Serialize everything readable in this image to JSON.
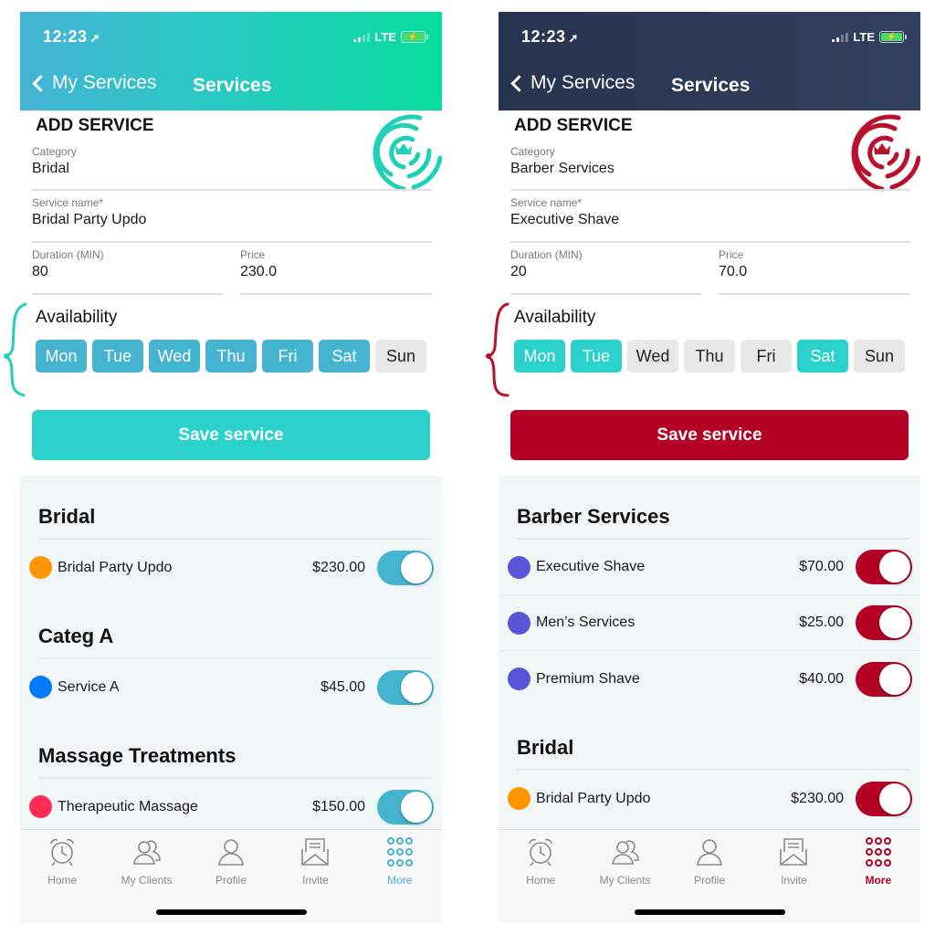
{
  "screens": [
    {
      "theme": {
        "accent": "#2bd1cb",
        "toggle": "#45b4d1",
        "day_selected": "#45b4d1",
        "logo": "#1fd1b6",
        "bracket": "#1fd1b6",
        "tab_active": "#45b4d5"
      },
      "status": {
        "time": "12:23",
        "location_icon": "location-arrow-icon",
        "network": "LTE"
      },
      "nav": {
        "back_label": "My Services",
        "title": "Services"
      },
      "form": {
        "title": "ADD SERVICE",
        "category": {
          "label": "Category",
          "value": "Bridal"
        },
        "service_name": {
          "label": "Service name*",
          "value": "Bridal Party Updo"
        },
        "duration": {
          "label": "Duration (MIN)",
          "value": "80"
        },
        "price": {
          "label": "Price",
          "value": "230.0"
        },
        "availability_label": "Availability",
        "days": [
          {
            "label": "Mon",
            "selected": true
          },
          {
            "label": "Tue",
            "selected": true
          },
          {
            "label": "Wed",
            "selected": true
          },
          {
            "label": "Thu",
            "selected": true
          },
          {
            "label": "Fri",
            "selected": true
          },
          {
            "label": "Sat",
            "selected": true
          },
          {
            "label": "Sun",
            "selected": false
          }
        ],
        "save_label": "Save service"
      },
      "groups": [
        {
          "title": "Bridal",
          "items": [
            {
              "name": "Bridal Party Updo",
              "price": "$230.00",
              "color": "#ff9500",
              "enabled": true
            }
          ]
        },
        {
          "title": "Categ A",
          "items": [
            {
              "name": "Service A",
              "price": "$45.00",
              "color": "#007aff",
              "enabled": true
            }
          ]
        },
        {
          "title": "Massage Treatments",
          "items": [
            {
              "name": "Therapeutic Massage",
              "price": "$150.00",
              "color": "#ff2d55",
              "enabled": true
            }
          ]
        }
      ],
      "tabs": [
        {
          "label": "Home",
          "icon": "alarm-clock-icon",
          "active": false
        },
        {
          "label": "My Clients",
          "icon": "clients-icon",
          "active": false
        },
        {
          "label": "Profile",
          "icon": "profile-icon",
          "active": false
        },
        {
          "label": "Invite",
          "icon": "envelope-icon",
          "active": false
        },
        {
          "label": "More",
          "icon": "grid-dots-icon",
          "active": true
        }
      ]
    },
    {
      "theme": {
        "accent": "#b30024",
        "toggle": "#b30024",
        "day_selected": "#2bd1cb",
        "logo": "#b8102d",
        "bracket": "#b8102d",
        "tab_active": "#b30024"
      },
      "status": {
        "time": "12:23",
        "location_icon": "location-arrow-icon",
        "network": "LTE"
      },
      "nav": {
        "back_label": "My Services",
        "title": "Services"
      },
      "form": {
        "title": "ADD SERVICE",
        "category": {
          "label": "Category",
          "value": "Barber Services"
        },
        "service_name": {
          "label": "Service name*",
          "value": "Executive Shave"
        },
        "duration": {
          "label": "Duration (MIN)",
          "value": "20"
        },
        "price": {
          "label": "Price",
          "value": "70.0"
        },
        "availability_label": "Availability",
        "days": [
          {
            "label": "Mon",
            "selected": true
          },
          {
            "label": "Tue",
            "selected": true
          },
          {
            "label": "Wed",
            "selected": false
          },
          {
            "label": "Thu",
            "selected": false
          },
          {
            "label": "Fri",
            "selected": false
          },
          {
            "label": "Sat",
            "selected": true
          },
          {
            "label": "Sun",
            "selected": false
          }
        ],
        "save_label": "Save service"
      },
      "groups": [
        {
          "title": "Barber Services",
          "items": [
            {
              "name": "Executive Shave",
              "price": "$70.00",
              "color": "#5856d6",
              "enabled": true
            },
            {
              "name": "Men’s Services",
              "price": "$25.00",
              "color": "#5856d6",
              "enabled": true
            },
            {
              "name": "Premium Shave",
              "price": "$40.00",
              "color": "#5856d6",
              "enabled": true
            }
          ]
        },
        {
          "title": "Bridal",
          "items": [
            {
              "name": "Bridal Party Updo",
              "price": "$230.00",
              "color": "#ff9500",
              "enabled": true
            }
          ]
        }
      ],
      "tabs": [
        {
          "label": "Home",
          "icon": "alarm-clock-icon",
          "active": false
        },
        {
          "label": "My Clients",
          "icon": "clients-icon",
          "active": false
        },
        {
          "label": "Profile",
          "icon": "profile-icon",
          "active": false
        },
        {
          "label": "Invite",
          "icon": "envelope-icon",
          "active": false
        },
        {
          "label": "More",
          "icon": "grid-dots-icon",
          "active": true
        }
      ]
    }
  ]
}
